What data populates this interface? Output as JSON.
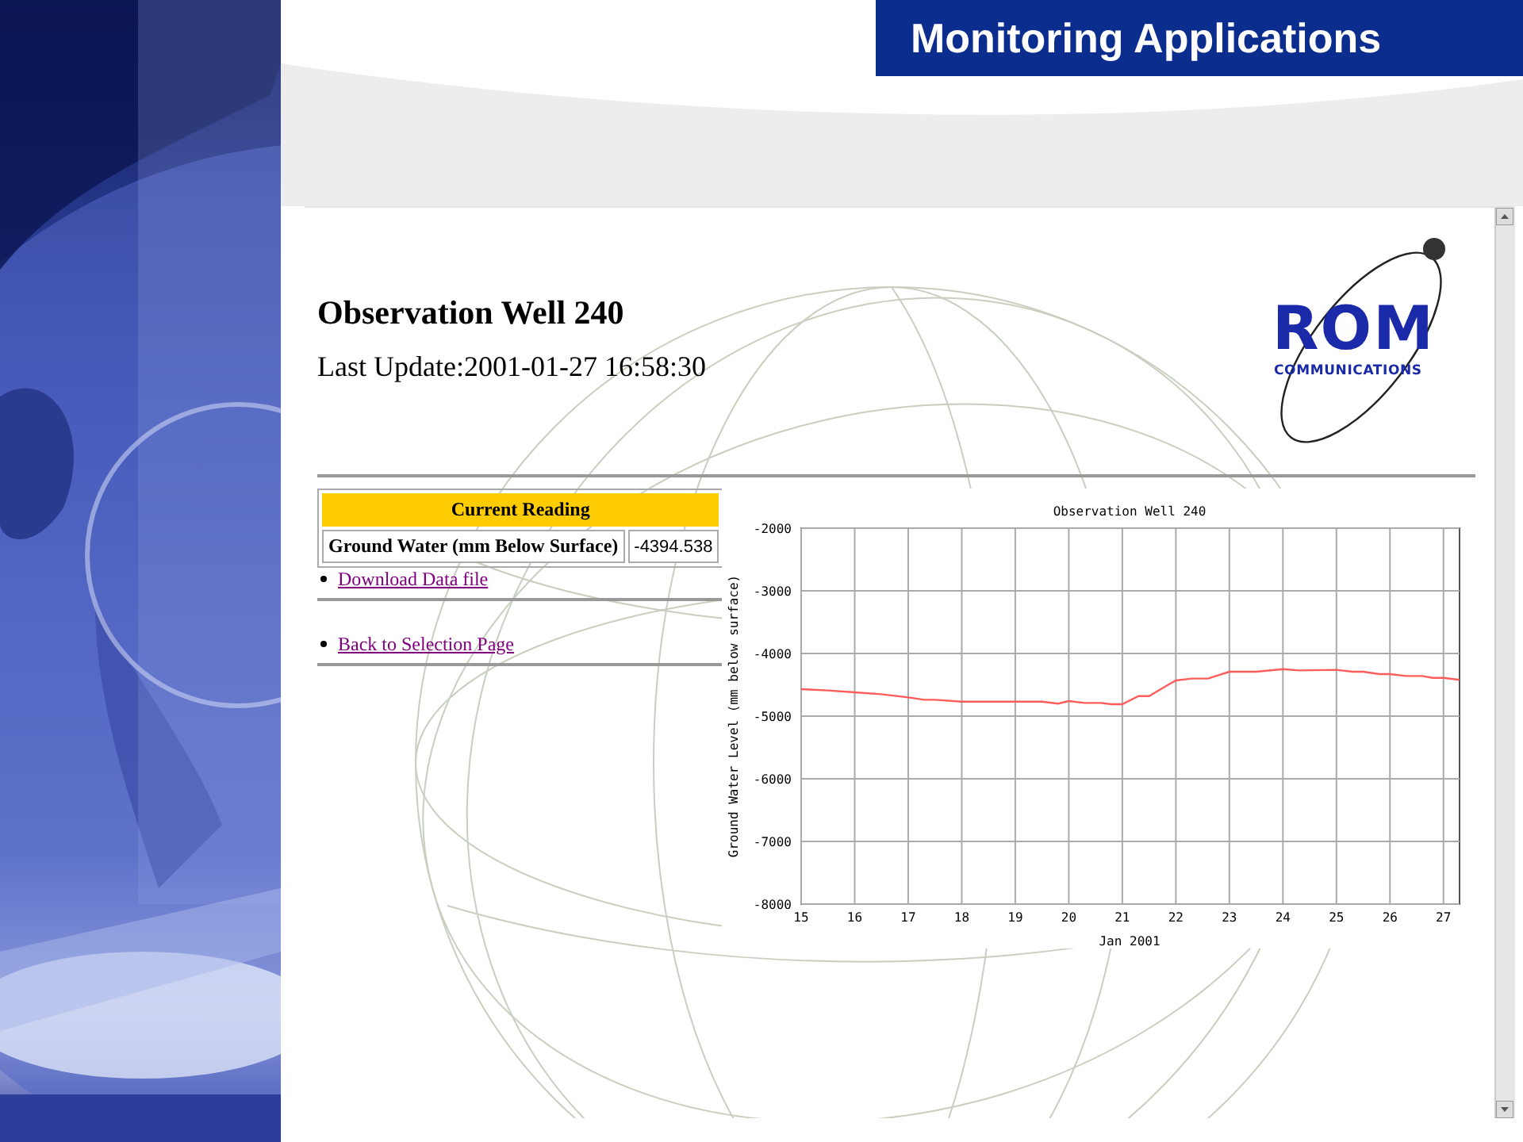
{
  "slide": {
    "title": "Monitoring Applications"
  },
  "web_page": {
    "heading": "Observation Well 240",
    "last_update": "Last Update:2001-01-27 16:58:30",
    "logo": {
      "name": "ROM",
      "tagline": "COMMUNICATIONS"
    },
    "reading_table": {
      "header": "Current Reading",
      "rows": [
        {
          "label": "Ground Water (mm Below Surface)",
          "value": "-4394.538"
        }
      ]
    },
    "links": [
      "Download Data file",
      "Back to Selection Page"
    ],
    "chart_data": {
      "type": "line",
      "title": "Observation Well 240",
      "xlabel": "Jan 2001",
      "ylabel": "Ground Water Level (mm below surface)",
      "x": [
        15,
        15.5,
        16,
        16.5,
        17,
        17.3,
        17.5,
        18,
        18.5,
        19,
        19.5,
        19.8,
        20,
        20.3,
        20.6,
        20.8,
        21,
        21.3,
        21.5,
        21.8,
        22,
        22.3,
        22.6,
        23,
        23.5,
        24,
        24.3,
        25,
        25.3,
        25.5,
        25.8,
        26,
        26.3,
        26.6,
        26.8,
        27,
        27.3
      ],
      "series": [
        {
          "color": "#ff5c5c",
          "values": [
            -4570,
            -4590,
            -4620,
            -4650,
            -4700,
            -4740,
            -4740,
            -4770,
            -4770,
            -4770,
            -4770,
            -4800,
            -4760,
            -4790,
            -4790,
            -4810,
            -4810,
            -4680,
            -4680,
            -4530,
            -4430,
            -4400,
            -4400,
            -4290,
            -4290,
            -4250,
            -4270,
            -4260,
            -4290,
            -4290,
            -4330,
            -4330,
            -4360,
            -4360,
            -4390,
            -4390,
            -4420
          ]
        }
      ],
      "xlim": [
        15,
        27.3
      ],
      "ylim": [
        -8000,
        -2000
      ],
      "xticks": [
        15,
        16,
        17,
        18,
        19,
        20,
        21,
        22,
        23,
        24,
        25,
        26,
        27
      ],
      "yticks": [
        -8000,
        -7000,
        -6000,
        -5000,
        -4000,
        -3000,
        -2000
      ],
      "grid": true
    }
  }
}
